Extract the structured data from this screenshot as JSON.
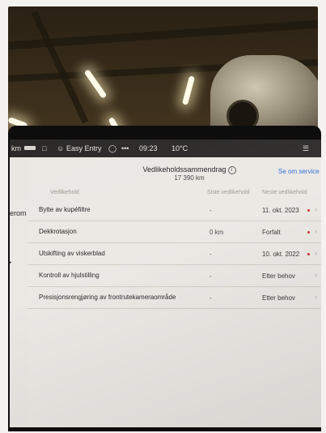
{
  "status_bar": {
    "range": "km",
    "profile_icon": "person-icon",
    "profile_name": "Easy Entry",
    "time": "09:23",
    "temperature": "10°C"
  },
  "sidebar": {
    "label_1": "jerom"
  },
  "summary": {
    "title": "Vedlikeholdssammendrag",
    "odometer": "17 390 km",
    "service_link": "Se om service"
  },
  "columns": {
    "item": "Vedlikehold",
    "since": "Siste vedlikehold",
    "next": "Neste vedlikehold"
  },
  "rows": [
    {
      "name": "Bytte av kupéfiltre",
      "since": "-",
      "next": "11. okt. 2023",
      "alert": true
    },
    {
      "name": "Dekkrotasjon",
      "since": "0 km",
      "next": "Forfalt",
      "alert": true
    },
    {
      "name": "Utskifting av viskerblad",
      "since": "-",
      "next": "10. okt. 2022",
      "alert": true
    },
    {
      "name": "Kontroll av hjulstilling",
      "since": "-",
      "next": "Etter behov",
      "alert": false
    },
    {
      "name": "Presisjonsrengjøring av frontrutekameraområde",
      "since": "-",
      "next": "Etter behov",
      "alert": false
    }
  ],
  "colors": {
    "link": "#2c6bd6",
    "alert": "#d12a2a"
  }
}
